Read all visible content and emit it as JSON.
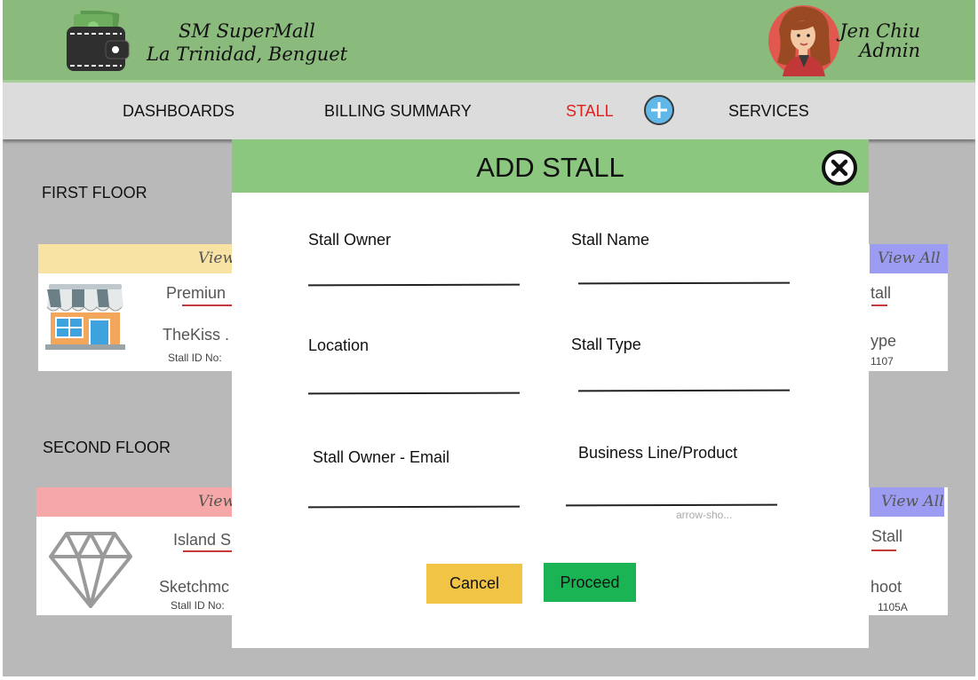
{
  "header": {
    "brand_line1": "SM SuperMall",
    "brand_line2": "La Trinidad, Benguet",
    "user_name": "Jen Chiu",
    "user_role": "Admin"
  },
  "nav": {
    "items": [
      "DASHBOARDS",
      "BILLING SUMMARY",
      "STALL",
      "SERVICES"
    ],
    "active": "STALL"
  },
  "floors": [
    {
      "label": "FIRST FLOOR",
      "cards": [
        {
          "head": "View",
          "title": "Premiun",
          "name": "TheKiss .",
          "id": "Stall ID No:"
        },
        {
          "head": "View All",
          "title": "tall",
          "name": "ype",
          "id": "1107"
        }
      ]
    },
    {
      "label": "SECOND FLOOR",
      "cards": [
        {
          "head": "View",
          "title": "Island S",
          "name": "Sketchmc",
          "id": "Stall ID No:"
        },
        {
          "head": "View All",
          "title": "Stall",
          "name": "hoot",
          "id": "1105A"
        }
      ]
    }
  ],
  "modal": {
    "title": "ADD STALL",
    "fields": {
      "owner": "Stall Owner",
      "name": "Stall Name",
      "location": "Location",
      "type": "Stall Type",
      "email": "Stall Owner - Email",
      "business": "Business Line/Product"
    },
    "business_hint": "arrow-sho...",
    "cancel_label": "Cancel",
    "proceed_label": "Proceed"
  },
  "colors": {
    "header_bg": "#8bba7d",
    "modal_head_bg": "#8cc77f",
    "cancel_bg": "#f1c445",
    "proceed_bg": "#1bb455",
    "active_nav": "#e0201d"
  }
}
